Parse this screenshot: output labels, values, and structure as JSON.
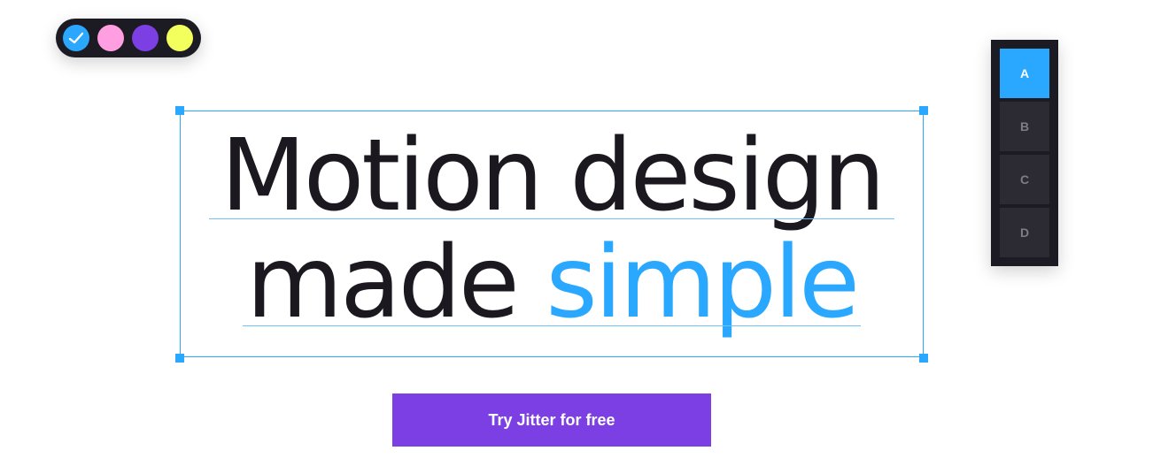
{
  "palette": {
    "swatches": [
      {
        "name": "blue",
        "color": "#2aa8ff",
        "selected": true,
        "icon": "check-icon"
      },
      {
        "name": "pink",
        "color": "#ff9ee0",
        "selected": false
      },
      {
        "name": "purple",
        "color": "#7b3fe4",
        "selected": false
      },
      {
        "name": "yellow",
        "color": "#f2ff5c",
        "selected": false
      }
    ]
  },
  "headline": {
    "line1": "Motion design",
    "line2_prefix": "made ",
    "line2_accent": "simple"
  },
  "cta": {
    "label": "Try Jitter for free"
  },
  "variants": {
    "items": [
      {
        "label": "A",
        "active": true
      },
      {
        "label": "B",
        "active": false
      },
      {
        "label": "C",
        "active": false
      },
      {
        "label": "D",
        "active": false
      }
    ]
  },
  "colors": {
    "accent": "#2aa8ff",
    "brand_purple": "#7b3fe4",
    "dark_panel": "#1c1a23",
    "text_dark": "#1b191f"
  }
}
